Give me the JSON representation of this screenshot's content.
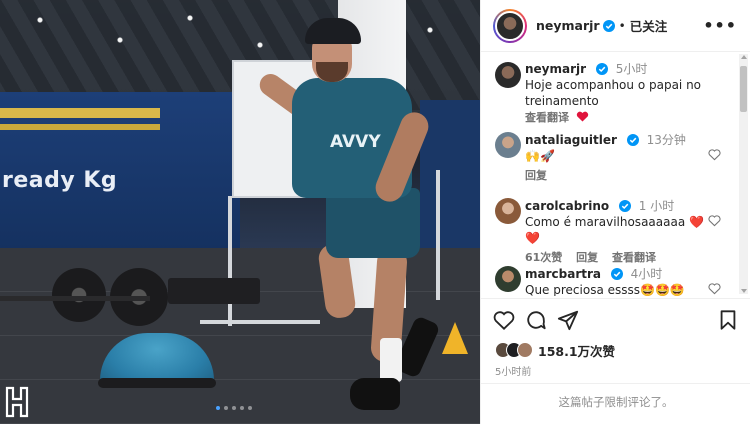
{
  "post_header": {
    "username": "neymarjr",
    "separator": "•",
    "follow_status": "已关注",
    "more_label": "•••"
  },
  "caption": {
    "username": "neymarjr",
    "time": "5小时",
    "text": "Hoje acompanhou o papai no treinamento",
    "translate": "查看翻译",
    "emoji": "heart-icon"
  },
  "comments": [
    {
      "username": "nataliaguitler",
      "time": "13分钟",
      "text": "🙌🚀",
      "actions": [
        "回复"
      ]
    },
    {
      "username": "carolcabrino",
      "time": "1 小时",
      "text": "Como é maravilhosaaaaaa ❤️❤️",
      "actions": [
        "61次赞",
        "回复",
        "查看翻译"
      ]
    },
    {
      "username": "marcbartra",
      "time": "4小时",
      "text": "Que preciosa essss🤩🤩🤩",
      "actions": []
    }
  ],
  "photo": {
    "wall_text": "ready Kg",
    "shirt_text": "AVVY",
    "carousel": {
      "count": 5,
      "active": 0
    }
  },
  "engagement": {
    "likes": "158.1万次赞",
    "posted": "5小时前",
    "comments_limited": "这篇帖子限制评论了。"
  },
  "colors": {
    "accent": "#0095f6",
    "heart": "#ed4956",
    "muted": "#8e8e8e"
  }
}
